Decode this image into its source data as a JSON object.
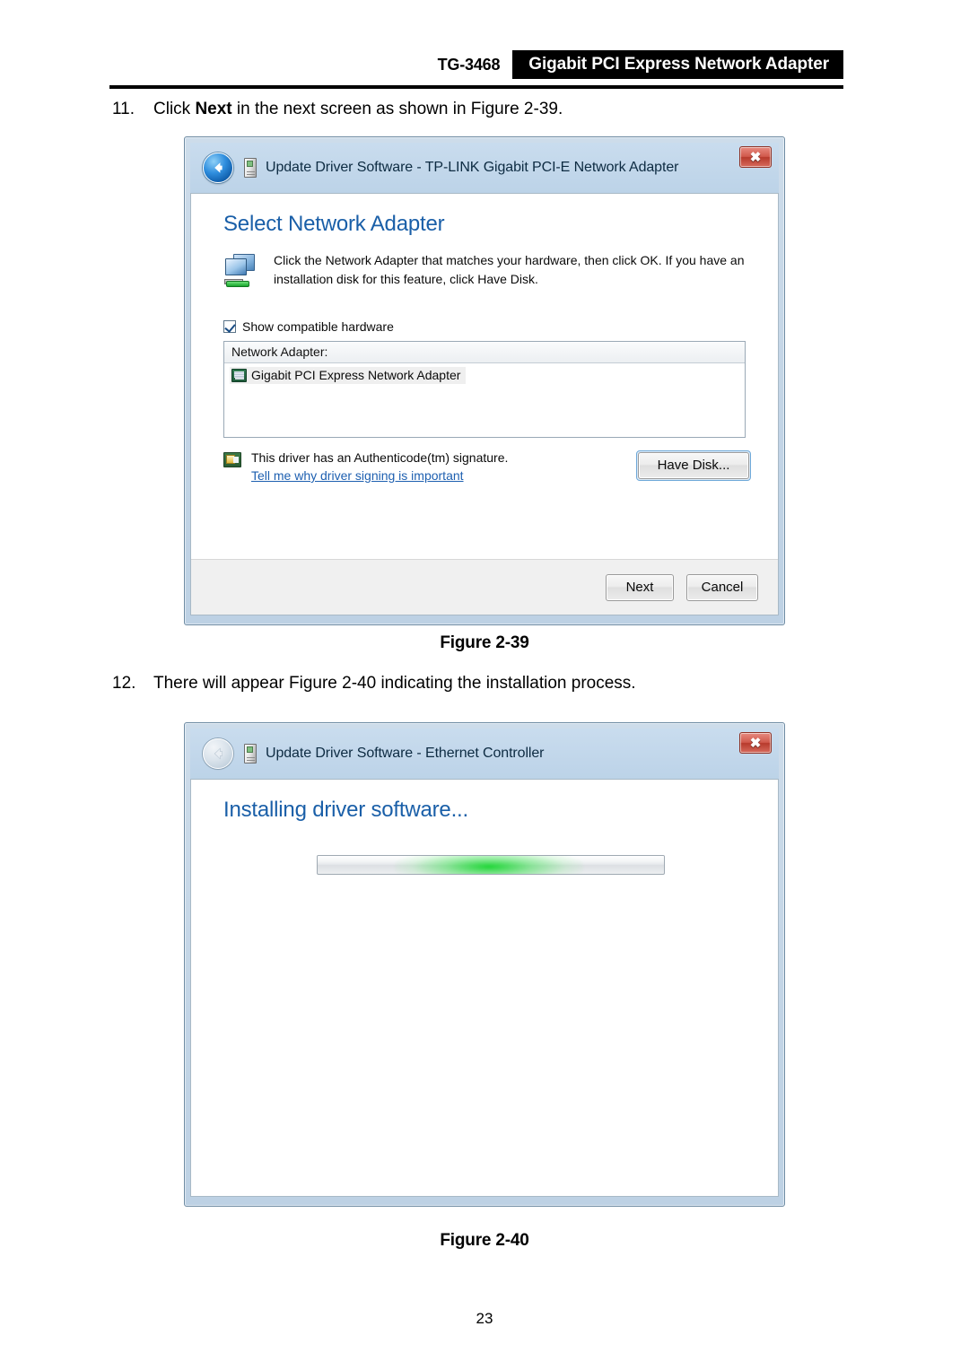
{
  "header": {
    "model": "TG-3468",
    "banner": "Gigabit PCI Express Network Adapter"
  },
  "steps": [
    {
      "number": "11.",
      "prefix": "Click ",
      "bold": "Next",
      "suffix": " in the next screen as shown in Figure 2-39."
    },
    {
      "number": "12.",
      "prefix": "There will appear Figure 2-40 indicating the installation process.",
      "bold": "",
      "suffix": ""
    }
  ],
  "figure_captions": {
    "fig39": "Figure 2-39",
    "fig40": "Figure 2-40"
  },
  "page_number": "23",
  "dialog1": {
    "title": "Update Driver Software - TP-LINK Gigabit PCI-E Network Adapter",
    "close_label": "✖",
    "back_icon": "back-arrow-icon",
    "heading": "Select Network Adapter",
    "description": "Click the Network Adapter that matches your hardware, then click OK. If you have an installation disk for this feature, click Have Disk.",
    "checkbox_label": "Show compatible hardware",
    "checkbox_checked": true,
    "list_header": "Network Adapter:",
    "list_items": [
      {
        "label": "Gigabit PCI Express Network Adapter",
        "selected": true
      }
    ],
    "signature_text": "This driver has an Authenticode(tm) signature.",
    "signature_link": "Tell me why driver signing is important",
    "have_disk_label": "Have Disk...",
    "next_label": "Next",
    "cancel_label": "Cancel"
  },
  "dialog2": {
    "title": "Update Driver Software - Ethernet Controller",
    "close_label": "✖",
    "back_icon": "back-arrow-icon-disabled",
    "heading": "Installing driver software...",
    "progress": {
      "mode": "marquee",
      "glow_color": "#16d62e"
    }
  }
}
